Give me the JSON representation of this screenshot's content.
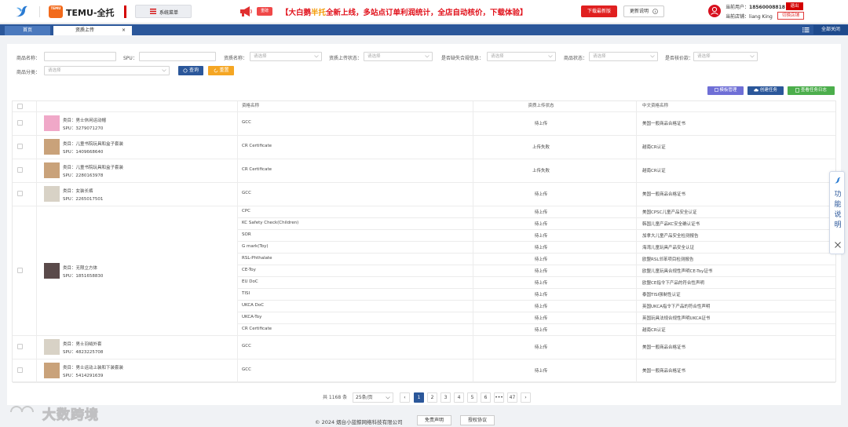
{
  "header": {
    "brand": "TEMU-全托",
    "temu_logo_text": "TEMU",
    "menu_button": "系统菜单",
    "hot_badge": "重磅",
    "announce_prefix": "【大白鹅",
    "announce_highlight": "半托",
    "announce_suffix": "全新上线，多站点订单利润统计，全店自动核价，下载体验】",
    "download_button": "下载最新版",
    "update_button": "更新说明",
    "current_user_label": "当前用户：",
    "current_user": "18560008818",
    "current_store_label": "当前店铺：",
    "current_store": "liang King",
    "logout_button": "退出",
    "switch_store_button": "切换店铺"
  },
  "tabs": {
    "home": "首页",
    "active": "资质上传",
    "close_glyph": "×",
    "close_all": "全部关闭"
  },
  "filters": {
    "product_name_label": "商品名称：",
    "spu_label": "SPU：",
    "qual_name_label": "资质名称：",
    "qual_status_label": "资质上传状态：",
    "missing_label": "是否缺失合规信息：",
    "product_status_label": "商品状态：",
    "price_label": "是否核价款：",
    "category_label": "商品分类：",
    "placeholder": "请选择",
    "query_button": "查询",
    "reset_button": "重置"
  },
  "actions": {
    "template": "模板管理",
    "create_task": "创建任务",
    "view_log": "查看任务日志"
  },
  "table": {
    "headers": {
      "qual_name": "资格名称",
      "upload_status": "资质上传状态",
      "cn_name": "中文资格名称"
    },
    "cat_prefix": "类目：",
    "spu_prefix": "SPU：",
    "products": [
      {
        "category": "男士休闲运动帽",
        "spu": "3279071270",
        "thumb": "pink"
      },
      {
        "category": "儿童书院玩具和盒子套装",
        "spu": "1409668640",
        "thumb": "tan"
      },
      {
        "category": "儿童书院玩具和盒子套装",
        "spu": "2280163978",
        "thumb": "tan"
      },
      {
        "category": "女装长裤",
        "spu": "2265017501",
        "thumb": "sketch"
      },
      {
        "category": "无限立方体",
        "spu": "1851658830",
        "thumb": "dark"
      },
      {
        "category": "男士羽绒外套",
        "spu": "4823225708",
        "thumb": "sketch"
      },
      {
        "category": "男士运动上装和下装套装",
        "spu": "5414291639",
        "thumb": "tan"
      }
    ],
    "rows": [
      {
        "name": "GCC",
        "status": "待上传",
        "cn": "美国一般商品合格证书"
      },
      {
        "name": "CR Certificate",
        "status": "上传失败",
        "cn": "越南CR认证"
      },
      {
        "name": "CR Certificate",
        "status": "上传失败",
        "cn": "越南CR认证"
      },
      {
        "name": "GCC",
        "status": "待上传",
        "cn": "美国一般商品合格证书"
      },
      {
        "name": "CPC",
        "status": "待上传",
        "cn": "美国CPSC儿童产品安全认证"
      },
      {
        "name": "KC Safety Check(Children)",
        "status": "待上传",
        "cn": "韩国儿童产品KC安全确认证书"
      },
      {
        "name": "SOR",
        "status": "待上传",
        "cn": "加拿大儿童产品安全检测报告"
      },
      {
        "name": "G mark(Toy)",
        "status": "待上传",
        "cn": "海湾儿童玩具产品安全认证"
      },
      {
        "name": "RSL-Phthalate",
        "status": "待上传",
        "cn": "欧盟RSL邻苯项目检测报告"
      },
      {
        "name": "CE-Toy",
        "status": "待上传",
        "cn": "欧盟儿童玩具合规性声明CE-Toy证书"
      },
      {
        "name": "EU DoC",
        "status": "待上传",
        "cn": "欧盟CE指令下产品的符合性声明"
      },
      {
        "name": "TISI",
        "status": "待上传",
        "cn": "泰国TISI强制性认证"
      },
      {
        "name": "UKCA DoC",
        "status": "待上传",
        "cn": "英国UKCA指令下产品的符合性声明"
      },
      {
        "name": "UKCA-Toy",
        "status": "待上传",
        "cn": "英国玩具法规合规性声明UKCA证书"
      },
      {
        "name": "CR Certificate",
        "status": "待上传",
        "cn": "越南CR认证"
      },
      {
        "name": "GCC",
        "status": "待上传",
        "cn": "美国一般商品合格证书"
      },
      {
        "name": "GCC",
        "status": "待上传",
        "cn": "美国一般商品合格证书"
      }
    ]
  },
  "pagination": {
    "total": "共 1168 条",
    "page_size": "25条/页",
    "prev": "‹",
    "next": "›",
    "pages": [
      "1",
      "2",
      "3",
      "4",
      "5",
      "6",
      "•••",
      "47"
    ],
    "current": "1"
  },
  "footer": {
    "copyright": "© 2024 烟台小蓝鲸网络科技有限公司",
    "disclaimer": "免责声明",
    "license": "授权协议"
  },
  "side_widget": {
    "label": "功能说明",
    "close_glyph": "×"
  },
  "watermark": "大数跨境",
  "colors": {
    "primary": "#2b579a",
    "danger": "#e02020",
    "warning": "#f5a623",
    "success": "#4cae4c",
    "purple": "#6f6fd6"
  }
}
